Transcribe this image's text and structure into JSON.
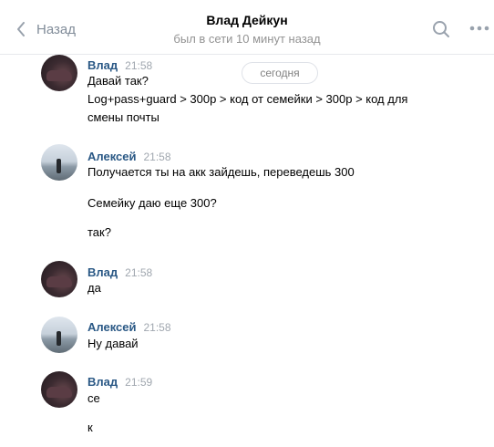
{
  "header": {
    "back_label": "Назад",
    "title": "Влад Дейкун",
    "status": "был в сети 10 минут назад"
  },
  "feed": {
    "date_label": "сегодня",
    "messages": [
      {
        "author": "Влад",
        "time": "21:58",
        "avatar": "vlad",
        "lines": [
          "Давай так?",
          "Log+pass+guard > 300р > код от семейки > 300р > код для",
          "смены почты"
        ]
      },
      {
        "author": "Алексей",
        "time": "21:58",
        "avatar": "aleksey",
        "lines": [
          "Получается ты на акк зайдешь, переведешь 300",
          "Семейку даю еще 300?",
          "так?"
        ]
      },
      {
        "author": "Влад",
        "time": "21:58",
        "avatar": "vlad",
        "lines": [
          "да"
        ]
      },
      {
        "author": "Алексей",
        "time": "21:58",
        "avatar": "aleksey",
        "lines": [
          "Ну давай"
        ]
      },
      {
        "author": "Влад",
        "time": "21:59",
        "avatar": "vlad",
        "lines": [
          "се",
          "к"
        ]
      }
    ]
  },
  "icons": {
    "back": "chevron-left-icon",
    "search": "search-icon",
    "more": "more-horizontal-icon"
  },
  "colors": {
    "author": "#2a5885",
    "muted": "#939393",
    "divider": "#e7e8ec"
  }
}
